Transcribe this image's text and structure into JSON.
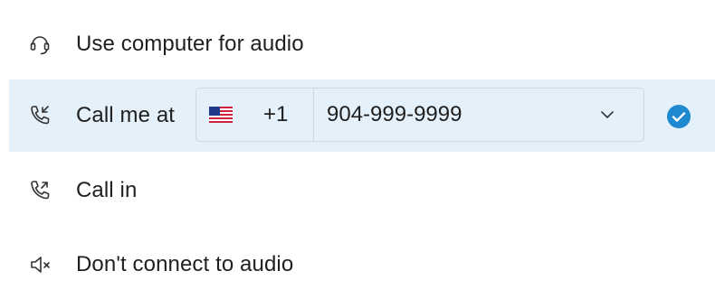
{
  "options": [
    {
      "label": "Use computer for audio",
      "icon": "headset-icon"
    },
    {
      "label": "Call me at",
      "icon": "phone-incoming-icon"
    },
    {
      "label": "Call in",
      "icon": "phone-outgoing-icon"
    },
    {
      "label": "Don't connect to audio",
      "icon": "speaker-mute-icon"
    }
  ],
  "call_me": {
    "country_flag": "us-flag-icon",
    "country_code": "+1",
    "phone_number": "904-999-9999",
    "selected": true
  },
  "colors": {
    "selected_row_bg": "#e5f1fa",
    "accent": "#1e88d0",
    "border": "#cfd6dc"
  }
}
